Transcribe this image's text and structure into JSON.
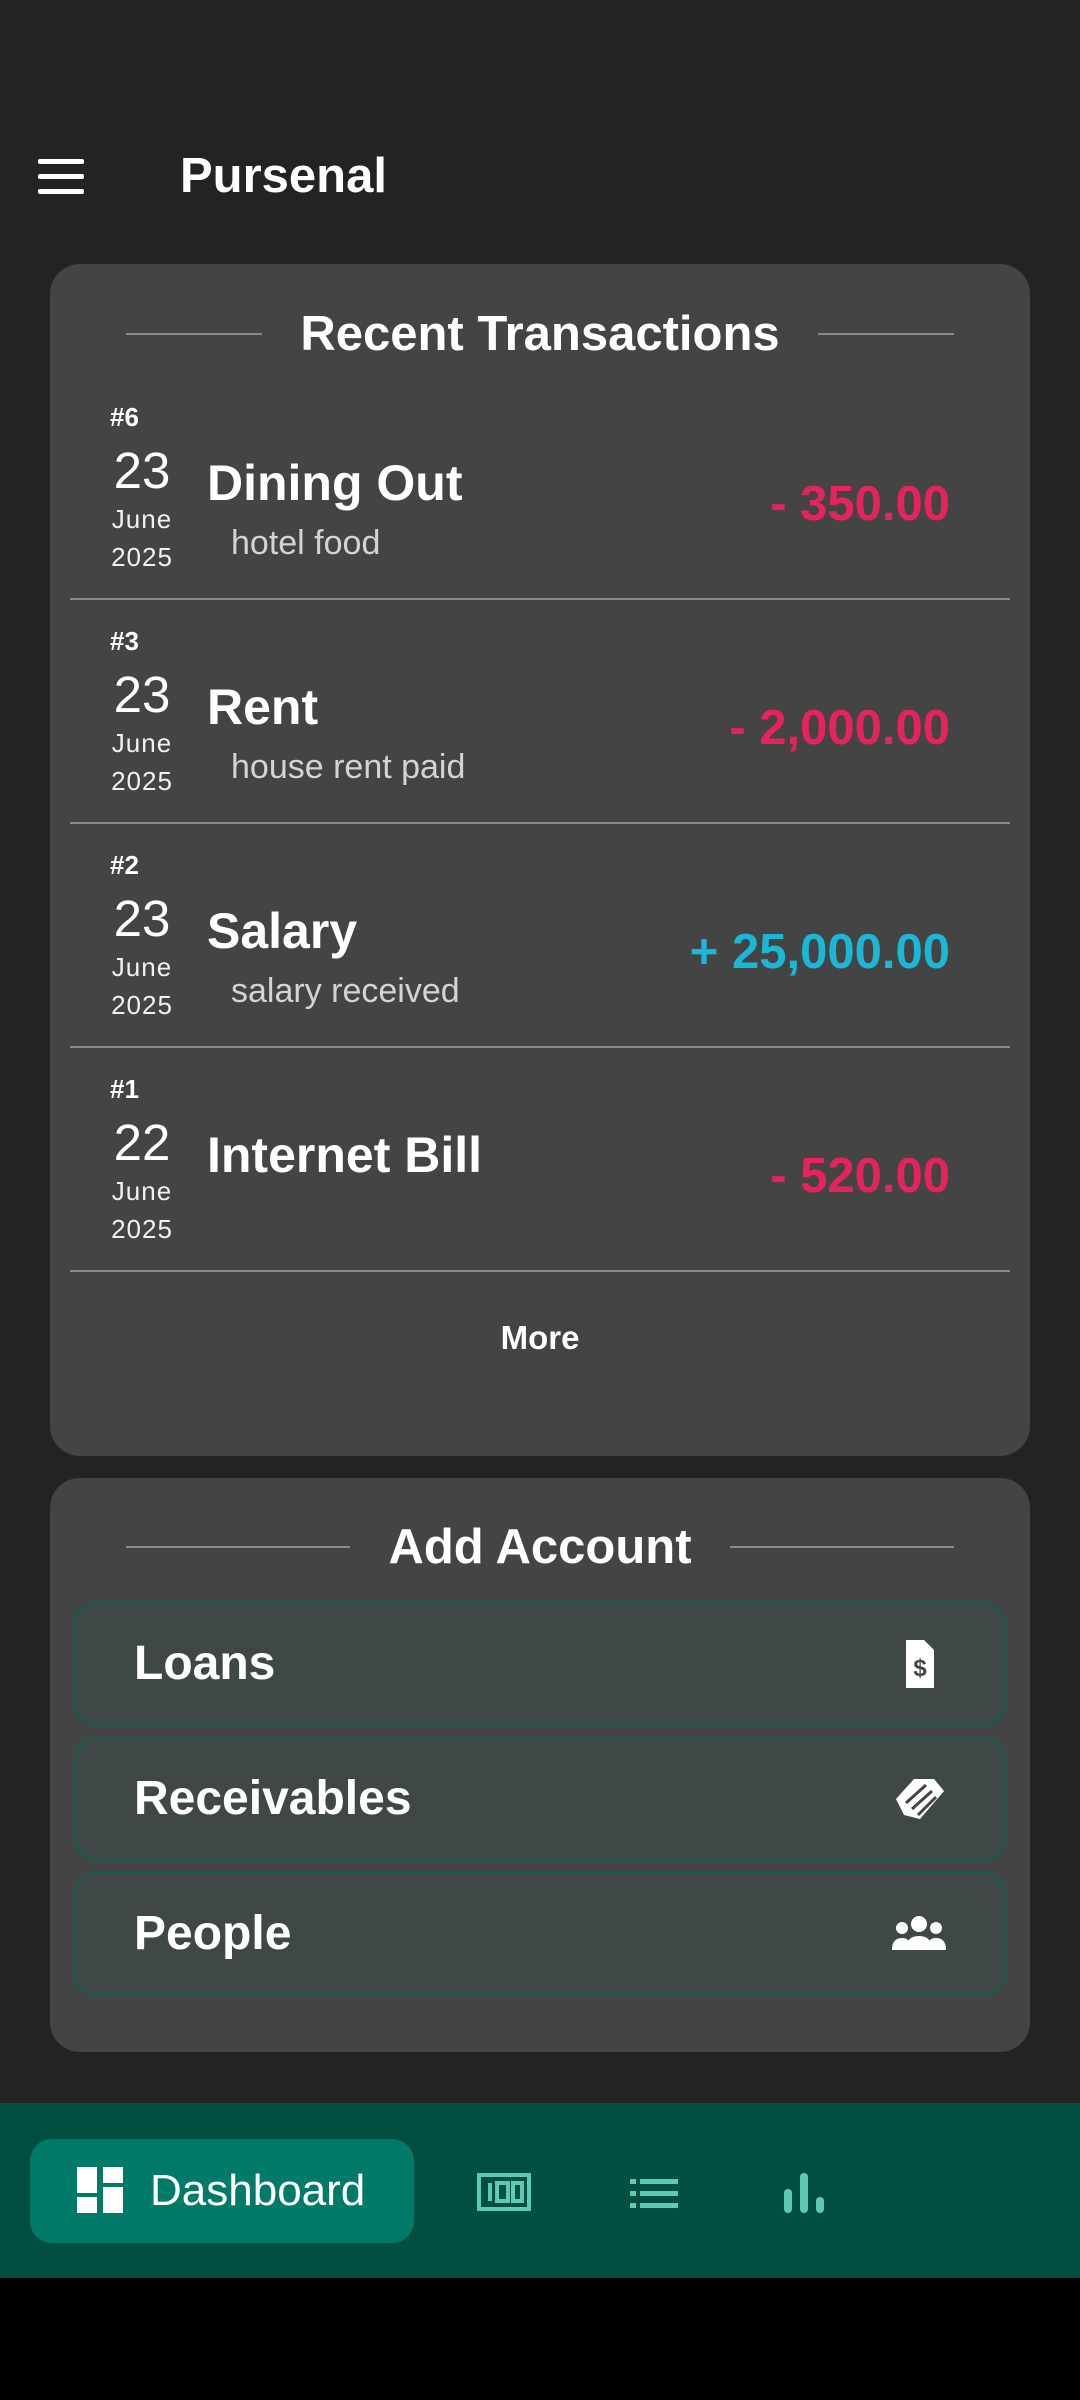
{
  "app": {
    "title": "Pursenal"
  },
  "recent": {
    "title": "Recent Transactions",
    "more_label": "More",
    "transactions": [
      {
        "index": "#6",
        "day": "23",
        "month": "June",
        "year": "2025",
        "name": "Dining Out",
        "note": "hotel food",
        "amount": "- 350.00",
        "type": "debit"
      },
      {
        "index": "#3",
        "day": "23",
        "month": "June",
        "year": "2025",
        "name": "Rent",
        "note": "house rent paid",
        "amount": "- 2,000.00",
        "type": "debit"
      },
      {
        "index": "#2",
        "day": "23",
        "month": "June",
        "year": "2025",
        "name": "Salary",
        "note": "salary received",
        "amount": "+ 25,000.00",
        "type": "credit"
      },
      {
        "index": "#1",
        "day": "22",
        "month": "June",
        "year": "2025",
        "name": "Internet Bill",
        "note": "",
        "amount": "- 520.00",
        "type": "debit"
      }
    ]
  },
  "add_account": {
    "title": "Add Account",
    "options": [
      {
        "label": "Loans",
        "icon": "loan-document-icon"
      },
      {
        "label": "Receivables",
        "icon": "handshake-icon"
      },
      {
        "label": "People",
        "icon": "people-icon"
      }
    ]
  },
  "bottom_nav": {
    "items": [
      {
        "label": "Dashboard",
        "icon": "dashboard-icon",
        "active": true
      },
      {
        "label": "",
        "icon": "money-icon",
        "active": false
      },
      {
        "label": "",
        "icon": "list-icon",
        "active": false
      },
      {
        "label": "",
        "icon": "bar-chart-icon",
        "active": false
      }
    ]
  },
  "colors": {
    "background": "#232323",
    "card": "#444444",
    "debit": "#e7235e",
    "credit": "#1ab8d6",
    "nav_bg": "#014e42",
    "nav_active": "#027a69",
    "nav_icon": "#5fc9b7"
  }
}
